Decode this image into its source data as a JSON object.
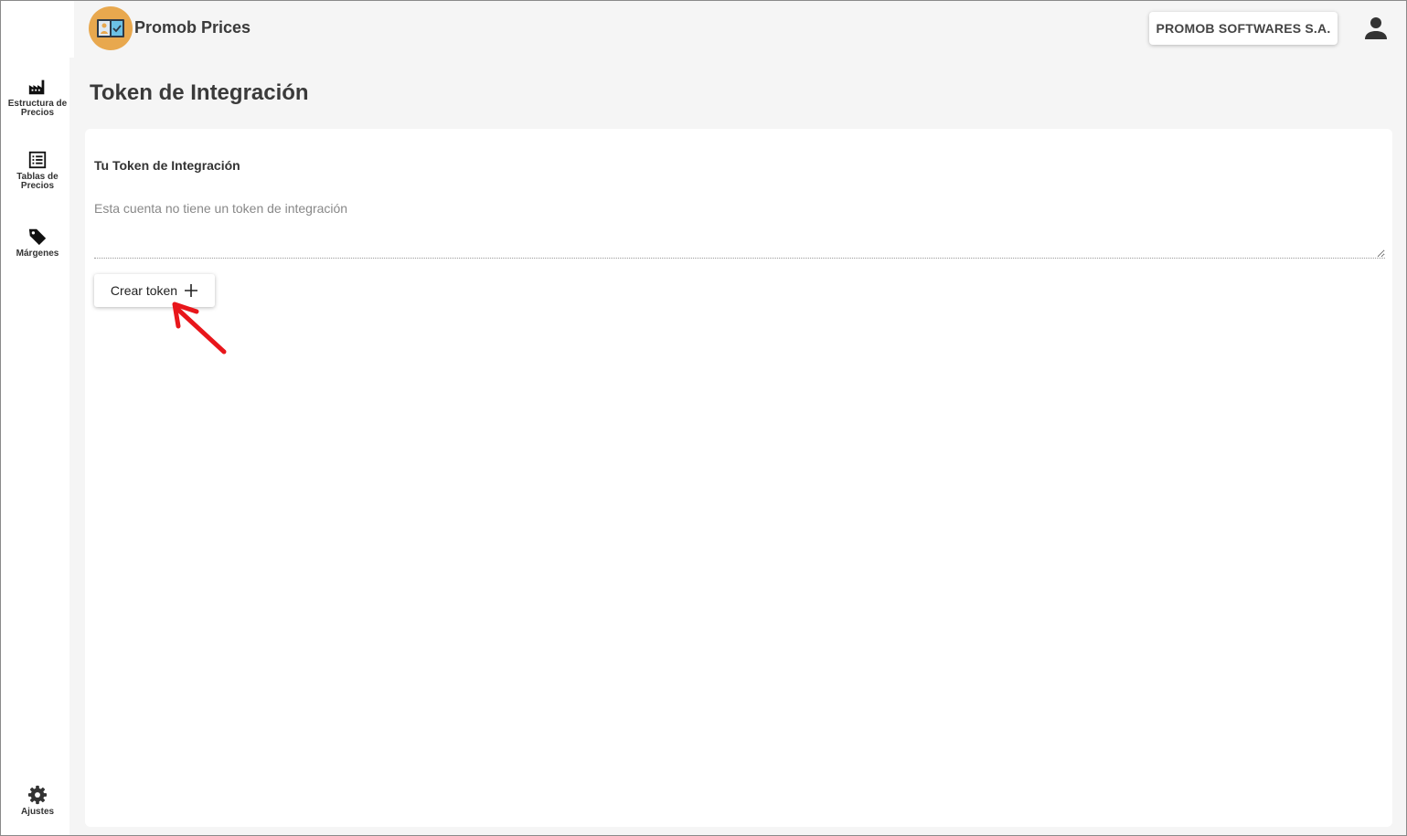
{
  "header": {
    "app_title": "Promob Prices",
    "company_button": "PROMOB SOFTWARES S.A.",
    "logo_icon": "price-board-icon",
    "user_icon": "user-icon"
  },
  "sidebar": {
    "items": [
      {
        "label": "Estructura de\nPrecios",
        "icon": "factory-icon"
      },
      {
        "label": "Tablas de\nPrecios",
        "icon": "list-icon"
      },
      {
        "label": "Márgenes",
        "icon": "tag-icon"
      },
      {
        "label": "Ajustes",
        "icon": "gear-icon"
      }
    ]
  },
  "main": {
    "page_title": "Token de Integración",
    "card": {
      "title": "Tu Token de Integración",
      "token_placeholder": "Esta cuenta no tiene un token de integración",
      "token_value": "",
      "create_button": "Crear token"
    }
  },
  "annotation": {
    "arrow_color": "#e8161b"
  },
  "colors": {
    "logo_bg": "#e8a84e",
    "background": "#f5f5f5",
    "card": "#ffffff"
  }
}
